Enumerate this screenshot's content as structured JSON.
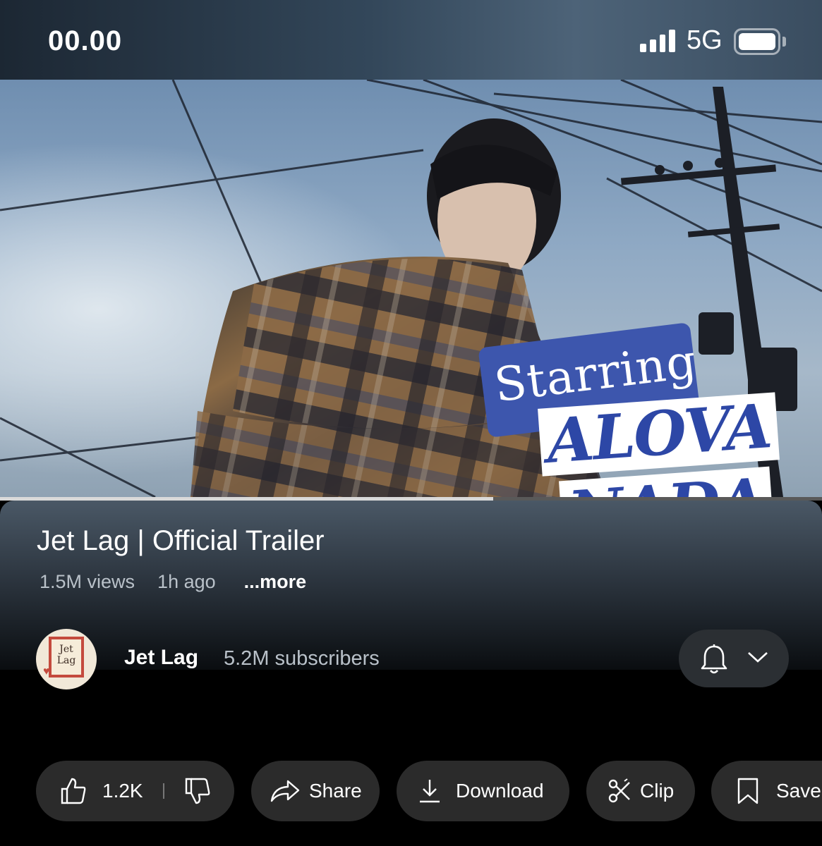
{
  "status_bar": {
    "time": "00.00",
    "network": "5G"
  },
  "video": {
    "overlay": {
      "starring": "Starring",
      "name_line1": "ALOVA",
      "name_line2": "NADA"
    },
    "progress": 0.6
  },
  "info": {
    "title": "Jet Lag | Official Trailer",
    "views": "1.5M views",
    "age": "1h ago",
    "more": "...more"
  },
  "channel": {
    "avatar_line1": "Jet",
    "avatar_line2": "Lag",
    "name": "Jet Lag",
    "subscribers": "5.2M subscribers"
  },
  "actions": {
    "like_count": "1.2K",
    "share": "Share",
    "download": "Download",
    "clip": "Clip",
    "save": "Save"
  }
}
